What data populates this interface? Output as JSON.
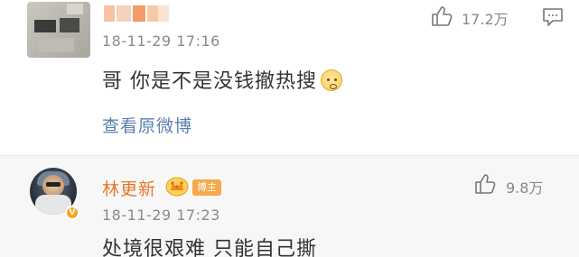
{
  "top_comment": {
    "timestamp": "18-11-29 17:16",
    "text": "哥 你是不是没钱撤热搜",
    "emoji": "sad-face-icon",
    "likes": "17.2万",
    "view_original": "查看原微博"
  },
  "reply": {
    "author": "林更新",
    "host_badge": "博主",
    "timestamp": "18-11-29 17:23",
    "text": "处境很艰难 只能自己撕",
    "likes": "9.8万"
  },
  "colors": {
    "author_name": "#e8762c",
    "link": "#5a7fb0",
    "host_badge": "#f4a94a",
    "reply_background": "#f7f7f7"
  }
}
